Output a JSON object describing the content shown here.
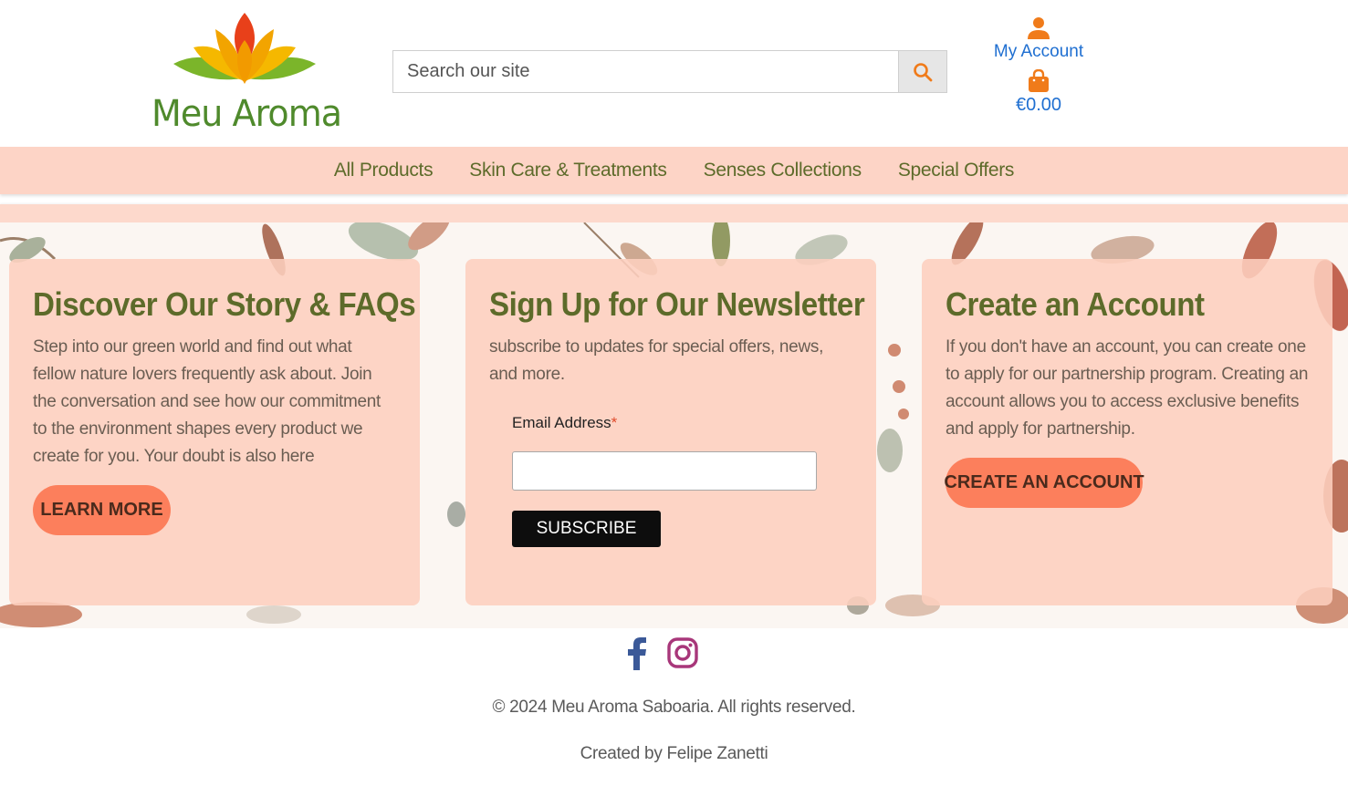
{
  "header": {
    "logo_text": "Meu Aroma",
    "search": {
      "placeholder": "Search our site",
      "value": ""
    },
    "account_label": "My Account",
    "cart_total": "€0.00"
  },
  "nav": {
    "items": [
      {
        "label": "All Products"
      },
      {
        "label": "Skin Care & Treatments"
      },
      {
        "label": "Senses Collections"
      },
      {
        "label": "Special Offers"
      }
    ]
  },
  "cards": {
    "story": {
      "title": "Discover Our Story & FAQs",
      "text": "Step into our green world and find out what fellow nature lovers frequently ask about. Join the conversation and see how our commitment to the environment shapes every product we create for you. Your doubt is also here",
      "button": "LEARN MORE"
    },
    "newsletter": {
      "title": "Sign Up for Our Newsletter",
      "text": "subscribe to updates for special offers, news, and more.",
      "email_label": "Email Address",
      "required_mark": "*",
      "button": "SUBSCRIBE"
    },
    "account": {
      "title": "Create an Account",
      "text": "If you don't have an account, you can create one to apply for our partnership program. Creating an account allows you to access exclusive benefits and apply for partnership.",
      "button": "CREATE AN ACCOUNT"
    }
  },
  "footer": {
    "social": [
      "facebook-icon",
      "instagram-icon"
    ],
    "copyright": "© 2024 Meu Aroma Saboaria. All rights reserved.",
    "credit": "Created by Felipe Zanetti"
  },
  "colors": {
    "accent_peach": "#fdd4c6",
    "button_coral": "#fc7f5c",
    "olive_text": "#5d6b2a",
    "link_blue": "#1f6fd1",
    "icon_orange": "#f07b1a"
  }
}
